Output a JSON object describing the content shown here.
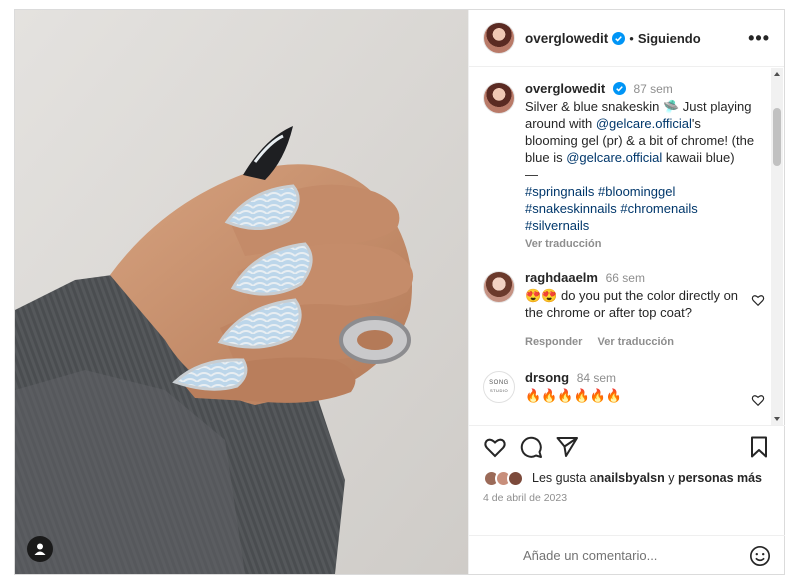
{
  "header": {
    "username": "overglowedit",
    "separator": "•",
    "follow_status": "Siguiendo",
    "more": "•••"
  },
  "caption": {
    "username": "overglowedit",
    "time": "87 sem",
    "text_1": "Silver & blue snakeskin 🛸 Just playing around with ",
    "mention_1": "@gelcare.official",
    "text_2": "'s blooming gel (pr) & a bit of chrome! (the blue is ",
    "mention_2": "@gelcare.official",
    "text_3": " kawaii blue)",
    "dash": "—",
    "hashtags": [
      "#springnails",
      "#bloominggel",
      "#snakeskinnails",
      "#chromenails",
      "#silvernails"
    ],
    "translate": "Ver traducción"
  },
  "comments": [
    {
      "username": "raghdaaelm",
      "time": "66 sem",
      "text": "😍😍 do you put the color directly on the chrome or after top coat?",
      "reply": "Responder",
      "translate": "Ver traducción"
    },
    {
      "username": "drsong",
      "time": "84 sem",
      "avatar_text": "SONG",
      "avatar_subtext": "STUDIO",
      "text": "🔥🔥🔥🔥🔥🔥"
    }
  ],
  "likes": {
    "prefix": "Les gusta a ",
    "user": "nailsbyalsn",
    "middle": " y ",
    "others": "personas más"
  },
  "date": "4 de abril de 2023",
  "comment_input": {
    "placeholder": "Añade un comentario..."
  },
  "colors": {
    "link": "#00376b",
    "verified": "#0095f6",
    "muted": "#8e8e8e",
    "nail_blue": "#bcd6ea"
  },
  "icons": [
    "like-icon",
    "comment-icon",
    "share-icon",
    "save-icon",
    "emoji-icon",
    "tag-user-icon",
    "verified-icon"
  ]
}
